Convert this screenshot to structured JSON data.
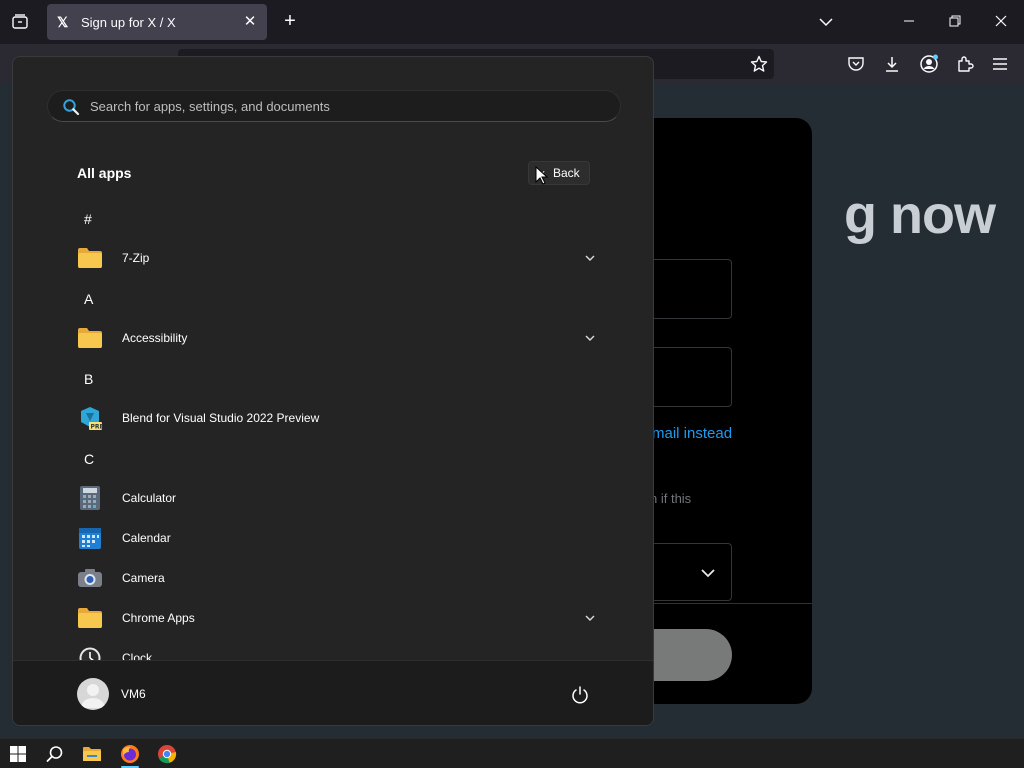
{
  "browser": {
    "tab_title": "Sign up for X / X",
    "tab_icon": "x-logo-icon",
    "tab_logo_text": "𝕏",
    "tab_close": "✕",
    "new_tab": "+"
  },
  "webpage": {
    "headline_fragment": "g now",
    "link_fragment": "mail instead",
    "note_fragment": "n if this"
  },
  "start_menu": {
    "search_placeholder": "Search for apps, settings, and documents",
    "section_title": "All apps",
    "back_label": "Back",
    "groups": [
      {
        "letter": "#",
        "apps": [
          {
            "name": "7-Zip",
            "icon": "folder-icon",
            "expandable": true
          }
        ]
      },
      {
        "letter": "A",
        "apps": [
          {
            "name": "Accessibility",
            "icon": "folder-icon",
            "expandable": true
          }
        ]
      },
      {
        "letter": "B",
        "apps": [
          {
            "name": "Blend for Visual Studio 2022 Preview",
            "icon": "blend-icon",
            "expandable": false
          }
        ]
      },
      {
        "letter": "C",
        "apps": [
          {
            "name": "Calculator",
            "icon": "calculator-icon",
            "expandable": false
          },
          {
            "name": "Calendar",
            "icon": "calendar-icon",
            "expandable": false
          },
          {
            "name": "Camera",
            "icon": "camera-icon",
            "expandable": false
          },
          {
            "name": "Chrome Apps",
            "icon": "folder-icon",
            "expandable": true
          },
          {
            "name": "Clock",
            "icon": "clock-icon",
            "expandable": false
          }
        ]
      }
    ],
    "user_name": "VM6"
  },
  "taskbar": {
    "items": [
      "start-icon",
      "search-icon",
      "file-explorer-icon",
      "firefox-icon",
      "chrome-icon"
    ],
    "active": "firefox-icon"
  },
  "colors": {
    "accent": "#60cdff",
    "folder": "#f6c84d",
    "link": "#1d9bf0"
  }
}
